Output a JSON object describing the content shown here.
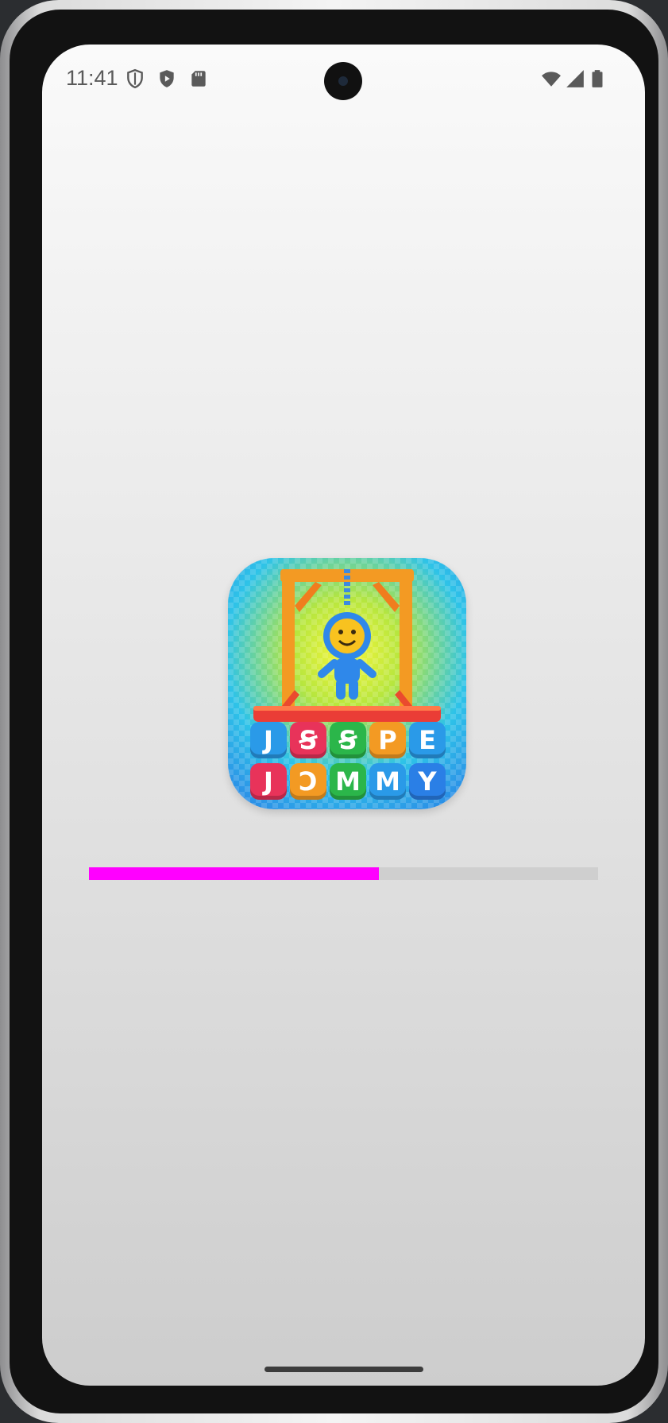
{
  "status_bar": {
    "time": "11:41",
    "left_icons": [
      "shield-outline-icon",
      "play-protect-icon",
      "sd-card-icon"
    ],
    "right_icons": [
      "wifi-icon",
      "cell-signal-icon",
      "battery-icon"
    ]
  },
  "splash": {
    "logo_tiles_row1": [
      "J",
      "Ꞩ",
      "Ꞩ",
      "P",
      "E"
    ],
    "logo_tiles_row2": [
      "J",
      "Ɔ",
      "M",
      "M",
      "Y"
    ],
    "colors": {
      "progress": "#ff00ff",
      "track": "#cfcfcf"
    },
    "progress_fraction": 0.57
  }
}
